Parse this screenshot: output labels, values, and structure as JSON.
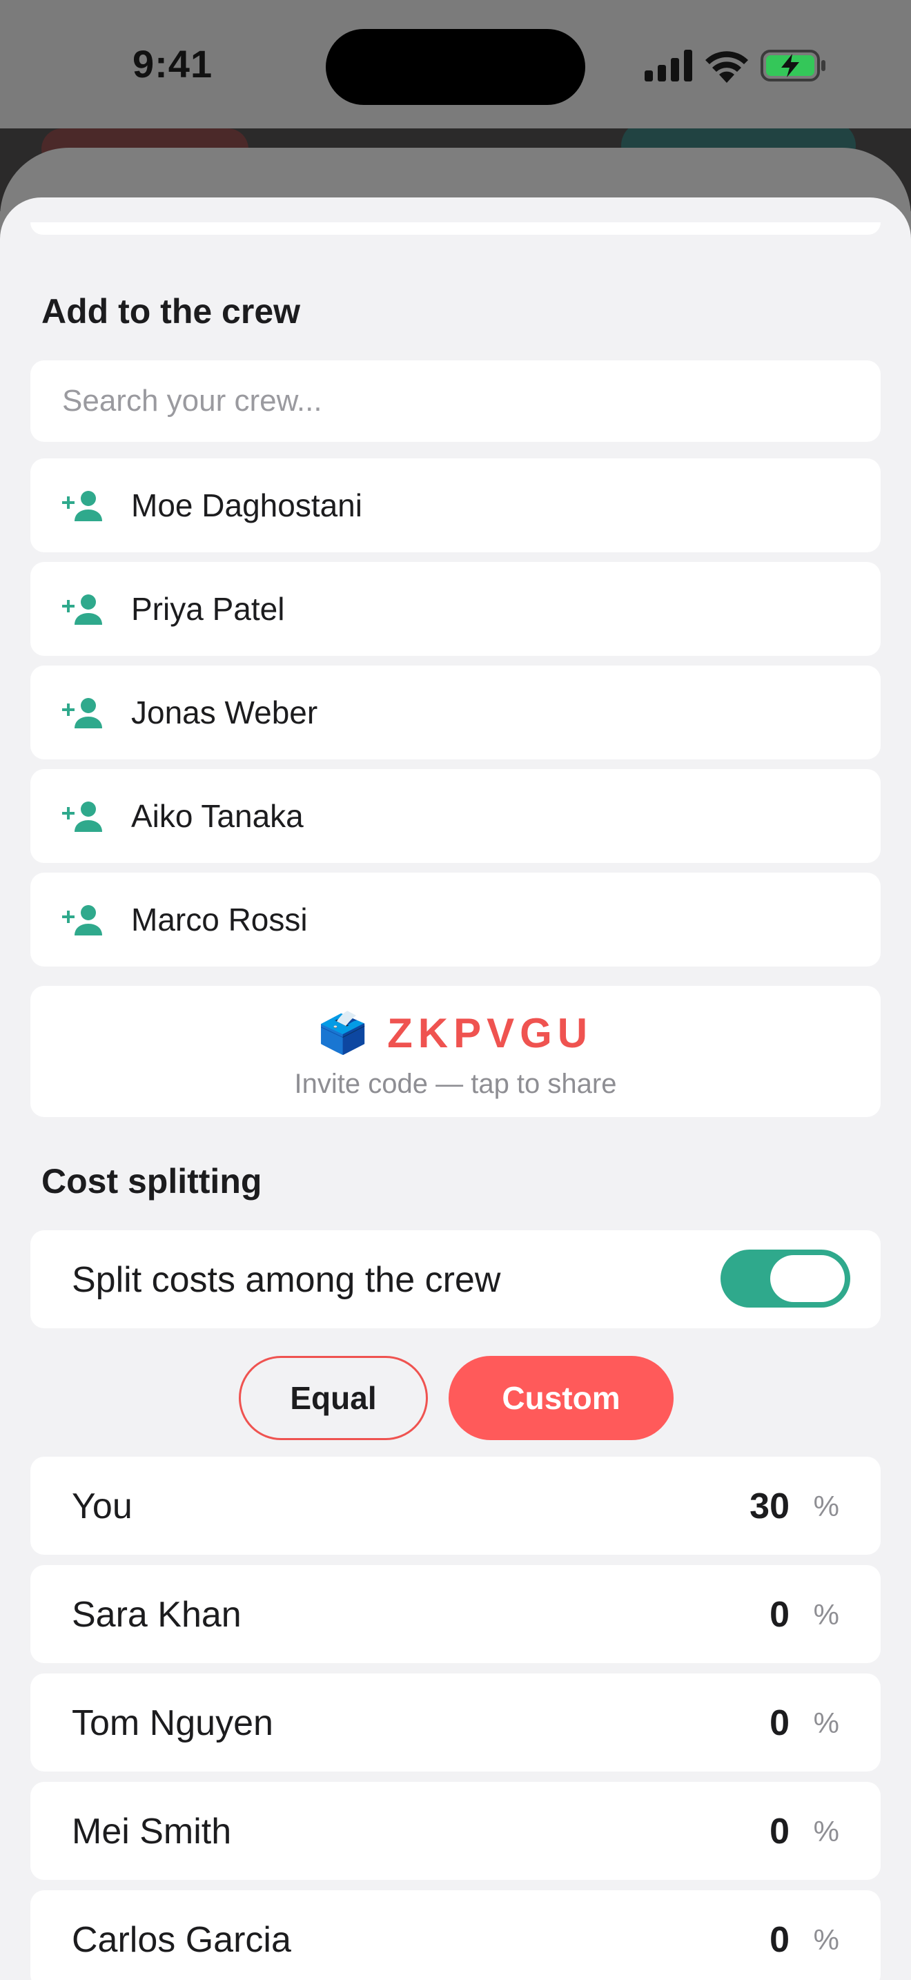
{
  "status_bar": {
    "time": "9:41"
  },
  "crew": {
    "title": "Add to the crew",
    "search_placeholder": "Search your crew...",
    "people": [
      "Moe Daghostani",
      "Priya Patel",
      "Jonas Weber",
      "Aiko Tanaka",
      "Marco Rossi"
    ]
  },
  "invite": {
    "emoji": "🗳️",
    "code": "ZKPVGU",
    "hint": "Invite code — tap to share"
  },
  "cost": {
    "title": "Cost splitting",
    "toggle_label": "Split costs among the crew",
    "toggle_on": true,
    "modes": {
      "equal": "Equal",
      "custom": "Custom"
    },
    "selected_mode": "Custom",
    "unit": "%",
    "shares": [
      {
        "name": "You",
        "value": "30"
      },
      {
        "name": "Sara Khan",
        "value": "0"
      },
      {
        "name": "Tom Nguyen",
        "value": "0"
      },
      {
        "name": "Mei Smith",
        "value": "0"
      },
      {
        "name": "Carlos Garcia",
        "value": "0"
      }
    ]
  },
  "colors": {
    "accent_red": "#ef5350",
    "custom_button": "#ff5a5a",
    "toggle_green": "#2fa98c",
    "icon_green": "#2fa98c"
  }
}
